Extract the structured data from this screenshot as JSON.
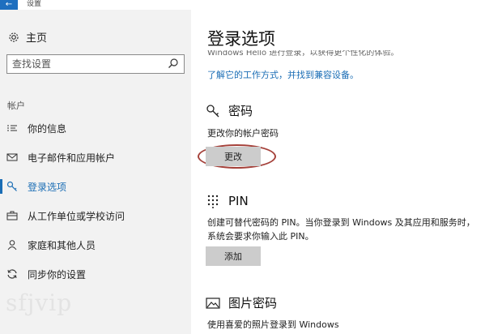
{
  "window": {
    "title": "设置",
    "back_glyph": "←"
  },
  "sidebar": {
    "home_label": "主页",
    "search_placeholder": "查找设置",
    "section_label": "帐户",
    "items": [
      {
        "label": "你的信息",
        "icon": "contact-card-icon"
      },
      {
        "label": "电子邮件和应用帐户",
        "icon": "mail-icon"
      },
      {
        "label": "登录选项",
        "icon": "key-icon",
        "active": true
      },
      {
        "label": "从工作单位或学校访问",
        "icon": "briefcase-icon"
      },
      {
        "label": "家庭和其他人员",
        "icon": "person-icon"
      },
      {
        "label": "同步你的设置",
        "icon": "sync-icon"
      }
    ],
    "watermark": "sfjvip"
  },
  "main": {
    "title": "登录选项",
    "cut_text": "Windows Hello 进行登录，以获得更个性化的体验。",
    "compat_link": "了解它的工作方式，并找到兼容设备。",
    "password": {
      "heading": "密码",
      "description": "更改你的帐户密码",
      "button": "更改"
    },
    "pin": {
      "heading": "PIN",
      "description_line1": "创建可替代密码的 PIN。当你登录到 Windows 及其应用和服务时，",
      "description_line2": "系统会要求你输入此 PIN。",
      "button": "添加"
    },
    "picture_password": {
      "heading": "图片密码",
      "description": "使用喜爱的照片登录到 Windows"
    }
  },
  "colors": {
    "accent": "#1a6db5",
    "sidebar_bg": "#f2f2f2",
    "button_bg": "#cccccc",
    "highlight_ring": "#a5413a"
  }
}
